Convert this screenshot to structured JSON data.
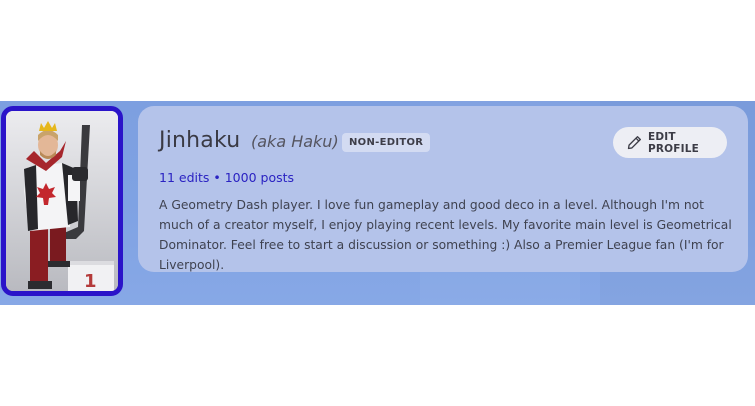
{
  "profile": {
    "username": "Jinhaku",
    "aka": "(aka Haku)",
    "role_badge": "NON-EDITOR",
    "stats": {
      "edits": "11 edits",
      "separator": "•",
      "posts": "1000 posts"
    },
    "bio": "A Geometry Dash player. I love fun gameplay and good deco in a level. Although I'm not much of a creator myself, I enjoy playing recent levels. My favorite main level is Geometrical Dominator. Feel free to start a discussion or something :) Also a Premier League fan (I'm for Liverpool).",
    "edit_button_label": "EDIT PROFILE",
    "edit_button_icon": "pencil-icon",
    "avatar_border_color": "#2a14c9",
    "banner_color": "#7fa2e3",
    "card_color": "#b4c3ea",
    "stats_color": "#2a22c2"
  }
}
